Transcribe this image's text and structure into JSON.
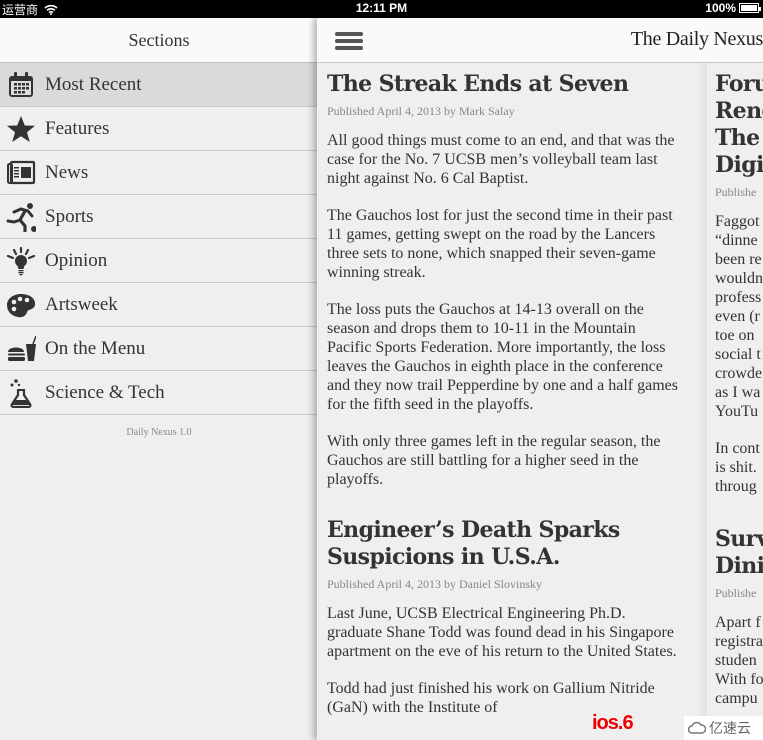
{
  "status_bar": {
    "carrier": "运营商",
    "time": "12:11 PM",
    "battery": "100%"
  },
  "sidebar": {
    "title": "Sections",
    "items": [
      {
        "label": "Most Recent",
        "icon": "calendar-icon",
        "active": true
      },
      {
        "label": "Features",
        "icon": "star-icon"
      },
      {
        "label": "News",
        "icon": "newspaper-icon"
      },
      {
        "label": "Sports",
        "icon": "runner-icon"
      },
      {
        "label": "Opinion",
        "icon": "lightbulb-icon"
      },
      {
        "label": "Artsweek",
        "icon": "palette-icon"
      },
      {
        "label": "On the Menu",
        "icon": "burger-drink-icon"
      },
      {
        "label": "Science & Tech",
        "icon": "flask-icon"
      }
    ],
    "version": "Daily Nexus 1.0"
  },
  "main": {
    "app_title": "The Daily Nexus",
    "menu_icon": "hamburger-icon",
    "column1": [
      {
        "title": "The Streak Ends at Seven",
        "meta": "Published April 4, 2013 by Mark Salay",
        "paragraphs": [
          "All good things must come to an end, and that was the case for the No. 7 UCSB men’s volleyball team last night against No. 6 Cal Baptist.",
          "The Gauchos lost for just the second time in their past 11 games, getting swept on the road by the Lancers three sets to none, which snapped their seven-game winning streak.",
          "The loss puts the Gauchos at 14-13 overall on the season and drops them to 10-11 in the Mountain Pacific Sports Federation. More importantly, the loss leaves the Gauchos in eighth place in the conference and they now trail Pepperdine by one and a half games for the fifth seed in the playoffs.",
          "With only three games left in the regular season, the Gauchos are still battling for a higher seed in the playoffs."
        ]
      },
      {
        "title": "Engineer’s Death Sparks Suspicions in U.S.A.",
        "meta": "Published April 4, 2013 by Daniel Slovinsky",
        "paragraphs": [
          "Last June, UCSB Electrical Engineering Ph.D. graduate Shane Todd was found dead in his Singapore apartment on the eve of his return to the United States.",
          "Todd had just finished his work on Gallium Nitride (GaN) with the Institute of"
        ]
      }
    ],
    "column2": [
      {
        "title": "Foru Rend The Digi",
        "meta": "Publishe",
        "paragraphs": [
          "Faggot “dinne been re wouldn profess even (r toe on social t crowde as I wa YouTu",
          "In cont is shit. throug"
        ]
      },
      {
        "title": "Surv Dini",
        "meta": "Publishe",
        "paragraphs": [
          "Apart f registra studen With fo campu"
        ]
      }
    ]
  },
  "watermark": {
    "red_text": "ios.6",
    "brand_text": "亿速云"
  }
}
